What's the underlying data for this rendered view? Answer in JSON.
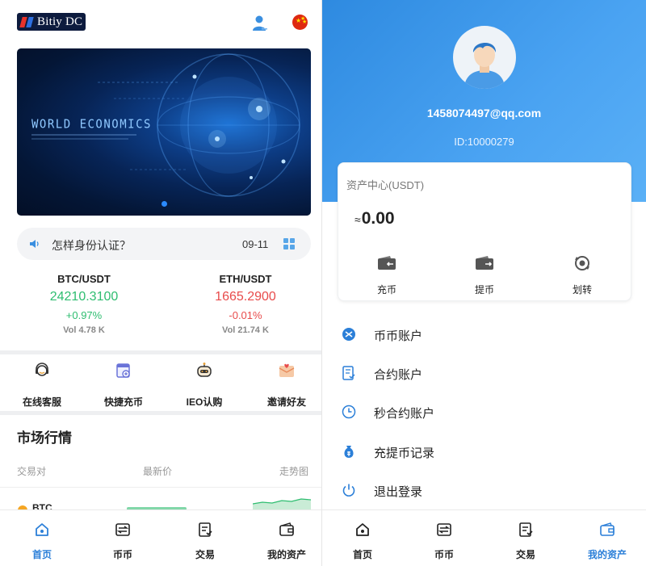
{
  "left": {
    "logo_text": "Bitiy DC",
    "banner": {
      "title": "WORLD ECONOMICS"
    },
    "notice": {
      "text": "怎样身份认证？",
      "date": "09-11"
    },
    "tickers": [
      {
        "pair": "BTC/USDT",
        "price": "24210.3100",
        "change": "+0.97%",
        "vol": "Vol 4.78 K",
        "trend": "up"
      },
      {
        "pair": "ETH/USDT",
        "price": "1665.2900",
        "change": "-0.01%",
        "vol": "Vol 21.74 K",
        "trend": "down"
      }
    ],
    "quick": [
      {
        "label": "在线客服",
        "icon": "headset-icon"
      },
      {
        "label": "快捷充币",
        "icon": "quick-deposit-icon"
      },
      {
        "label": "IEO认购",
        "icon": "robot-icon"
      },
      {
        "label": "邀请好友",
        "icon": "invite-envelope-icon"
      }
    ],
    "market": {
      "title": "市场行情",
      "headers": [
        "交易对",
        "最新价",
        "走势图"
      ],
      "partial_row": "BTC"
    },
    "tabs": [
      {
        "label": "首页",
        "icon": "home-icon",
        "active": true
      },
      {
        "label": "币币",
        "icon": "coin-exchange-icon",
        "active": false
      },
      {
        "label": "交易",
        "icon": "trade-icon",
        "active": false
      },
      {
        "label": "我的资产",
        "icon": "wallet-icon",
        "active": false
      }
    ]
  },
  "right": {
    "profile": {
      "email": "1458074497@qq.com",
      "uid": "ID:10000279"
    },
    "asset": {
      "label": "资产中心(USDT)",
      "approx": "≈",
      "value": "0.00",
      "actions": [
        {
          "label": "充币",
          "icon": "deposit-wallet-icon"
        },
        {
          "label": "提币",
          "icon": "withdraw-wallet-icon"
        },
        {
          "label": "划转",
          "icon": "transfer-icon"
        }
      ]
    },
    "menu": [
      {
        "label": "币币账户",
        "icon": "coin-account-icon"
      },
      {
        "label": "合约账户",
        "icon": "contract-account-icon"
      },
      {
        "label": "秒合约账户",
        "icon": "clock-icon"
      },
      {
        "label": "充提币记录",
        "icon": "money-bag-icon"
      },
      {
        "label": "退出登录",
        "icon": "power-icon"
      }
    ],
    "tabs": [
      {
        "label": "首页",
        "icon": "home-icon",
        "active": false
      },
      {
        "label": "币币",
        "icon": "coin-exchange-icon",
        "active": false
      },
      {
        "label": "交易",
        "icon": "trade-icon",
        "active": false
      },
      {
        "label": "我的资产",
        "icon": "wallet-icon",
        "active": true
      }
    ]
  },
  "colors": {
    "accent": "#2b7fd8",
    "up": "#2ebd70",
    "down": "#e84b4b",
    "hero": "#3d98ea"
  }
}
